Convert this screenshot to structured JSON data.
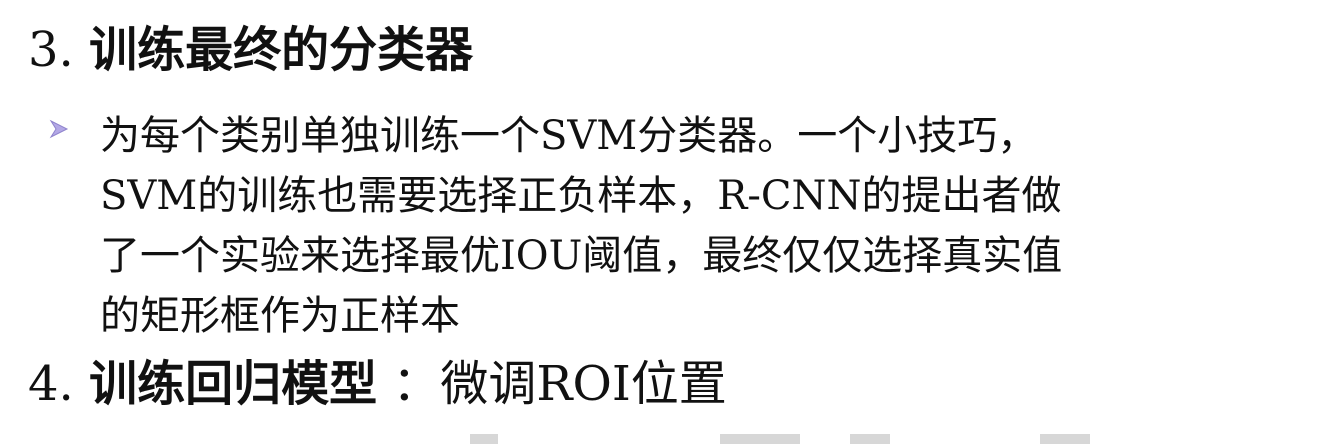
{
  "section3": {
    "number": "3.",
    "title": "训练最终的分类器"
  },
  "bullet": {
    "lines": [
      "为每个类别单独训练一个SVM分类器。一个小技巧，",
      "SVM的训练也需要选择正负样本，R-CNN的提出者做",
      "了一个实验来选择最优IOU阈值，最终仅仅选择真实值",
      "的矩形框作为正样本"
    ]
  },
  "section4": {
    "number": "4.",
    "title": "训练回归模型",
    "suffix": "：微调ROI位置"
  },
  "colors": {
    "text": "#111111",
    "bullet_arrow": "#9b8fd6"
  },
  "icons": {
    "bullet": "arrow-bullet-icon"
  }
}
